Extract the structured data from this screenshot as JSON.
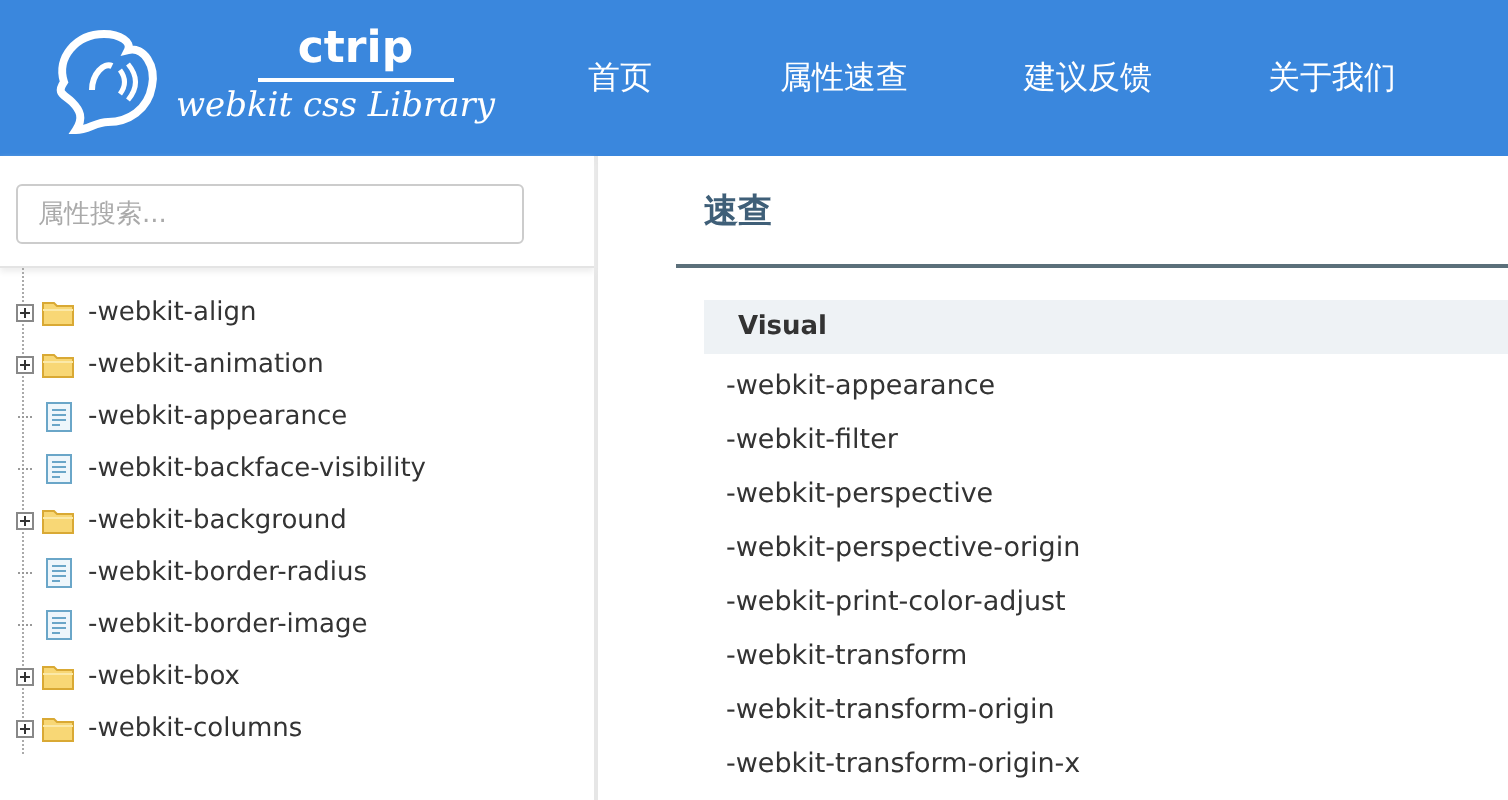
{
  "header": {
    "logo_brand": "ctrip",
    "logo_subtitle": "webkit css Library",
    "nav": [
      {
        "label": "首页",
        "selected": false
      },
      {
        "label": "属性速查",
        "selected": false
      },
      {
        "label": "建议反馈",
        "selected": false
      },
      {
        "label": "关于我们",
        "selected": false
      }
    ]
  },
  "sidebar": {
    "search": {
      "placeholder": "属性搜索..."
    },
    "tree": [
      {
        "label": "-webkit-align",
        "kind": "folder",
        "expanded": false
      },
      {
        "label": "-webkit-animation",
        "kind": "folder",
        "expanded": false
      },
      {
        "label": "-webkit-appearance",
        "kind": "file"
      },
      {
        "label": "-webkit-backface-visibility",
        "kind": "file"
      },
      {
        "label": "-webkit-background",
        "kind": "folder",
        "expanded": false
      },
      {
        "label": "-webkit-border-radius",
        "kind": "file"
      },
      {
        "label": "-webkit-border-image",
        "kind": "file"
      },
      {
        "label": "-webkit-box",
        "kind": "folder",
        "expanded": false
      },
      {
        "label": "-webkit-columns",
        "kind": "folder",
        "expanded": false
      }
    ]
  },
  "main": {
    "title": "速查",
    "group": {
      "heading": "Visual",
      "items": [
        "-webkit-appearance",
        "-webkit-filter",
        "-webkit-perspective",
        "-webkit-perspective-origin",
        "-webkit-print-color-adjust",
        "-webkit-transform",
        "-webkit-transform-origin",
        "-webkit-transform-origin-x"
      ]
    }
  }
}
